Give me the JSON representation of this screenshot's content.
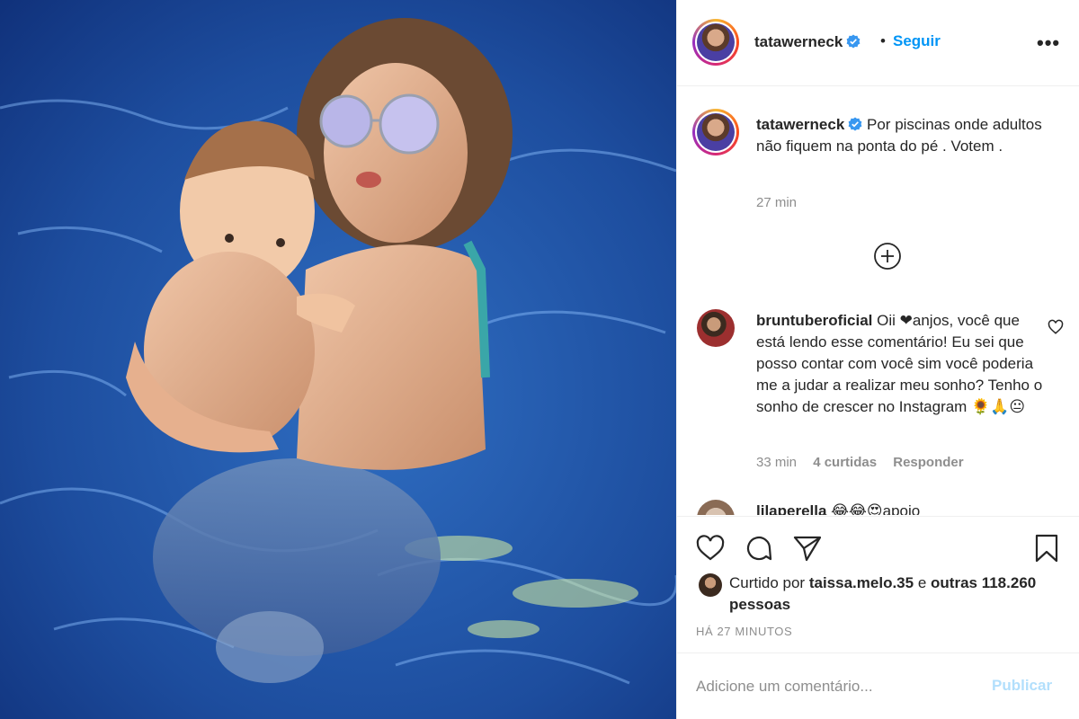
{
  "post": {
    "image_alt": "photo",
    "author": {
      "username": "tatawerneck",
      "verified": true,
      "follow_label": "Seguir",
      "separator": "•",
      "more_label": "•••"
    },
    "caption": {
      "username": "tatawerneck",
      "text": "Por piscinas onde adultos não fiquem na ponta do pé . Votem .",
      "time": "27 min"
    },
    "comments": [
      {
        "username": "bruntuberoficial",
        "text": "Oii ❤anjos, você que está lendo esse comentário! Eu sei que posso contar com você sim você poderia me a judar a realizar meu sonho? Tenho o sonho de crescer no Instagram 🌻🙏😐",
        "time": "33 min",
        "likes": "4 curtidas",
        "reply_label": "Responder"
      },
      {
        "username": "lilaperella",
        "text": "😂😂😍apoio"
      }
    ],
    "likes": {
      "prefix": "Curtido por",
      "user": "taissa.melo.35",
      "connector": "e",
      "others": "outras 118.260 pessoas"
    },
    "timestamp": "HÁ 27 MINUTOS",
    "add_comment": {
      "placeholder": "Adicione um comentário...",
      "publish_label": "Publicar"
    }
  },
  "colors": {
    "accent": "#0095f6",
    "publish_disabled": "#b2dffc",
    "secondary_text": "#8e8e8e",
    "border": "#efefef"
  },
  "icons": [
    "verified-badge-icon",
    "more-options-icon",
    "load-more-icon",
    "heart-icon",
    "comment-icon",
    "share-icon",
    "bookmark-icon",
    "comment-like-heart-icon"
  ]
}
